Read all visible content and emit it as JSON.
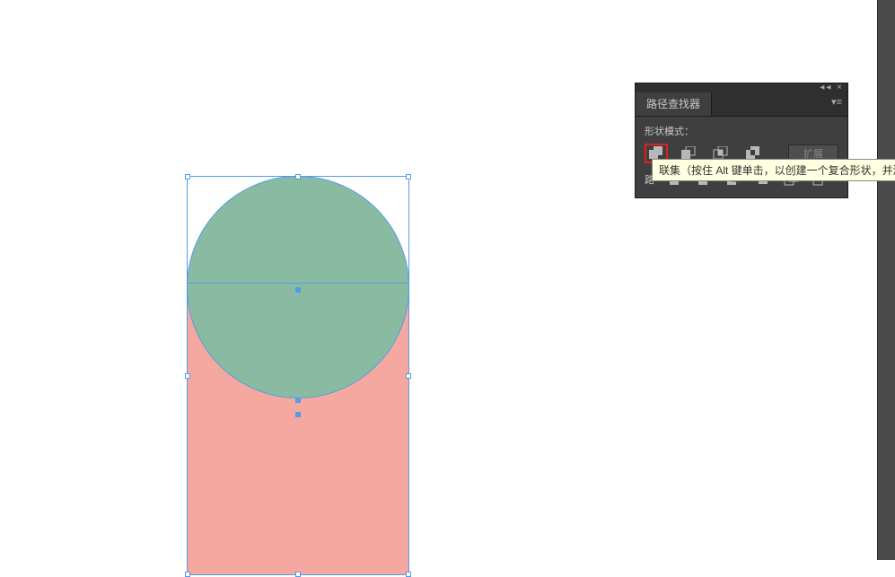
{
  "canvas": {
    "shapes": {
      "circle_color": "#89bba3",
      "rect_color": "#f5a8a0",
      "selection_color": "#539ce8"
    }
  },
  "panel": {
    "title": "路径查找器",
    "collapse_glyph": "◂◂",
    "close_glyph": "×",
    "menu_glyph": "▾≡",
    "shape_modes_label": "形状模式：",
    "expand_label": "扩展",
    "pathfinders_label_short": "路",
    "shape_mode_icons": [
      {
        "name": "unite-icon"
      },
      {
        "name": "minus-front-icon"
      },
      {
        "name": "intersect-icon"
      },
      {
        "name": "exclude-icon"
      }
    ],
    "pathfinder_icons": [
      {
        "name": "divide-icon"
      },
      {
        "name": "trim-icon"
      },
      {
        "name": "merge-icon"
      },
      {
        "name": "crop-icon"
      },
      {
        "name": "outline-icon"
      },
      {
        "name": "minus-back-icon"
      }
    ]
  },
  "tooltip": {
    "text": "联集（按住 Alt 键单击，以创建一个复合形状，并添"
  }
}
